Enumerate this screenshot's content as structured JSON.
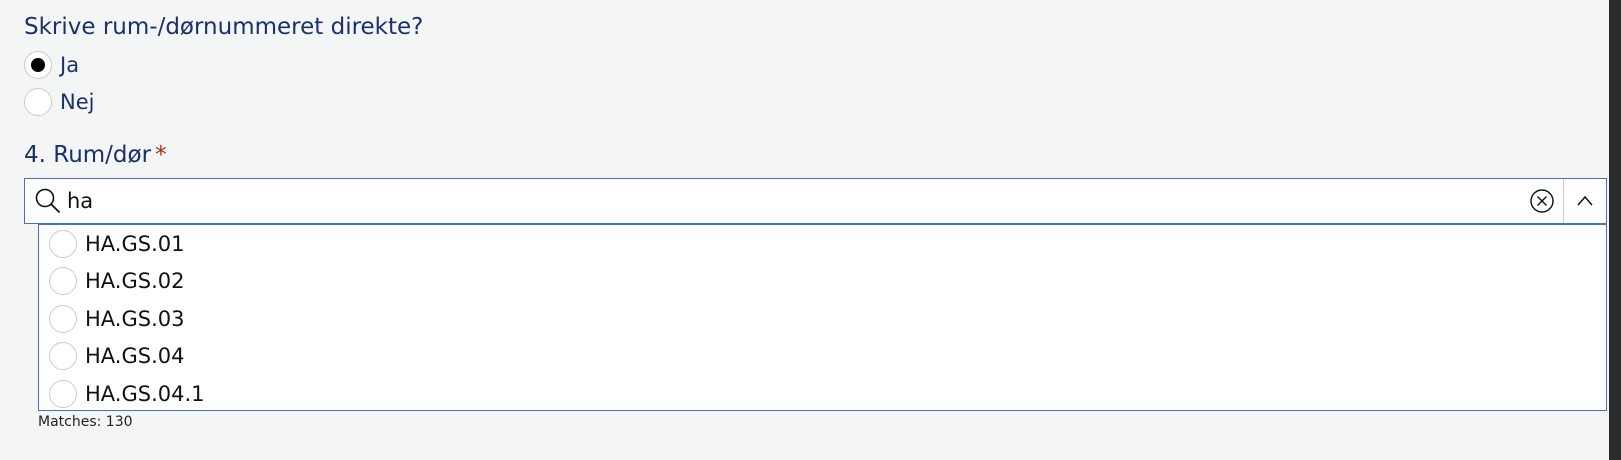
{
  "question": "Skrive rum-/dørnummeret direkte?",
  "radio_options": [
    {
      "label": "Ja",
      "selected": true
    },
    {
      "label": "Nej",
      "selected": false
    }
  ],
  "field": {
    "label": "4. Rum/dør",
    "required_marker": "*",
    "search_value": "ha",
    "search_icon": "search-icon",
    "clear_icon": "clear-icon",
    "toggle_icon": "chevron-up-icon"
  },
  "results": [
    "HA.GS.01",
    "HA.GS.02",
    "HA.GS.03",
    "HA.GS.04",
    "HA.GS.04.1"
  ],
  "matches_text": "Matches: 130",
  "colors": {
    "label_text": "#1c2f6e",
    "required": "#b3261e",
    "border_focus": "#4f6ec4",
    "background": "#f4f6f6"
  }
}
